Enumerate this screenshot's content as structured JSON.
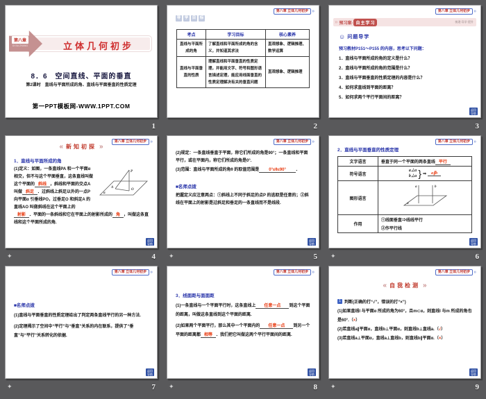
{
  "colors": {
    "background": "#59595b",
    "accent_red": "#c0392b",
    "answer_red": "#e8380d",
    "heading_blue": "#2531a8",
    "rose": "#c59191"
  },
  "chrome": {
    "transition_glyph": "✦",
    "page_numbers": [
      "1",
      "2",
      "3",
      "4",
      "5",
      "6",
      "7",
      "8",
      "9"
    ]
  },
  "common": {
    "chip_text": "第八章 立体几何初步",
    "chip_arrows": "»",
    "back_line1": "返回",
    "back_line2": "导航",
    "badge_l": "«",
    "badge_r": "»"
  },
  "s1": {
    "chapter": "第八章",
    "pinyin": "DI BA ZHANG",
    "title": "立体几何初步",
    "section": "8．6　空间直线、平面的垂直",
    "subtitle": "第2课时　直线与平面所成的角、直线与平面垂直的性质定理",
    "site": "第一PPT模板网-WWW.1PPT.COM"
  },
  "s2": {
    "stamps": [
      "导",
      "学",
      "目",
      "标"
    ],
    "table": {
      "headers": [
        "考点",
        "学习目标",
        "核心素养"
      ],
      "rows": [
        [
          "直线与平面所成的角",
          "了解直线和平面所成的角的含义，并知道其求法",
          "直观想象、逻辑推理、数学运算"
        ],
        [
          "直线与平面垂直的性质",
          "理解直线和平面垂直的性质定理，并能用文字、符号和图形语言描述定理，能应用线面垂直的性质定理解决有关的垂直问题",
          "直观想象、逻辑推理"
        ]
      ]
    }
  },
  "s3": {
    "banner_left": "预习案·",
    "banner_box": "自主学习",
    "banner_right": "梳理·导学·提升",
    "smiley": "☺",
    "qd_title": "问题导学",
    "lead": "预习教材P151～P155 的内容，思考以下问题：",
    "questions": [
      "1．直线与平面所成的角的定义是什么？",
      "2．直线与平面所成的角的范围是什么？",
      "3．直线与平面垂直的性质定理的内容是什么？",
      "4．如何求直线到平面的距离？",
      "5．如何求两个平行平面间的距离？"
    ]
  },
  "s4": {
    "badge": "新知初探",
    "heading": "1．直线与平面所成的角",
    "t1": "(1)定义：如图，一条直线PA 和一个平面α 相交，但不与这个平面垂直，这条直线叫做这个平面的",
    "b1": "斜线",
    "t2": "，斜线和平面的交点A 叫做",
    "b2": "斜足",
    "t3": "．过斜线上斜足以外的一点P 向平面α 引垂线PO，过垂足O 和斜足A 的直线AO 叫做斜线在这个平面上的",
    "b3": "射影",
    "t4": "．平面的一条斜线和它在平面上的射影所成的",
    "b4": "角",
    "t5": "，叫做这条直线和这个平面所成的角.",
    "fig": {
      "P": "P",
      "A": "A",
      "O": "O",
      "alpha": "α"
    }
  },
  "s5": {
    "p1": "(2)规定：一条直线垂直于平面，称它们所成的角是90°；一条直线和平面平行，或在平面内，称它们所成的角是0°.",
    "p2a": "(3)范围：直线与平面所成的角θ 的取值范围是",
    "p2b": "0°≤θ≤90°",
    "p2c": "．",
    "head": "■名师点拨",
    "p3": "把握定义应注意两点：①斜线上不同于斜足的点P 的选取是任意的；②斜线在平面上的射影是过斜足和垂足的一条直线而不是线段."
  },
  "s6": {
    "heading": "2．直线与平面垂直的性质定理",
    "r1_label": "文字语言",
    "r1_text": "垂直于同一个平面的两条直线",
    "r1_blank": "平行",
    "r2_label": "符号语言",
    "r2_l1": "a⊥α",
    "r2_l2": "b⊥α",
    "r2_brace": "}",
    "r2_arrow": "⇒",
    "r2_blank": "a∥b",
    "r3_label": "图形语言",
    "r3_a": "a",
    "r3_b": "b",
    "r3_alpha": "α",
    "r4_label": "作用",
    "r4_l1": "①线面垂直⇒线线平行",
    "r4_l2": "②作平行线"
  },
  "s7": {
    "head": "■名师点拨",
    "p1": "(1)直线与平面垂直的性质定理给出了判定两条直线平行的另一种方法.",
    "p2": "(2)定理揭示了空间中“平行”与“垂直”关系的内在联系，提供了“垂直”与“平行”关系转化的依据."
  },
  "s8": {
    "heading": "3．线面距与面面距",
    "t1": "(1)一条直线与一个平面平行时，这条直线上",
    "b1": "任意一点",
    "t2": "到这个平面的距离，叫做这条直线到这个平面的距离.",
    "t3": "(2)如果两个平面平行，那么其中一个平面内的",
    "b2": "任意一点",
    "t4": "到另一个平面的距离都",
    "b3": "相等",
    "t5": "．我们把它叫做这两个平行平面间的距离."
  },
  "s9": {
    "badge": "自我检测",
    "qicon": "1",
    "lead": "判断(正确的打“√”，错误的打“×”)",
    "items": [
      {
        "pre": "(1)如果直线l 与平面α 所成的角为60°，且m⊂α，则直线l 与m 所成的角也是60°.（",
        "mark": "×",
        "post": "）"
      },
      {
        "pre": "(2)若直线a∥平面α，直线b⊥平面α，则直线b⊥直线a.（",
        "mark": "√",
        "post": "）"
      },
      {
        "pre": "(3)若直线a⊥平面α，直线a⊥直线b，则直线b∥平面α.（",
        "mark": "×",
        "post": "）"
      }
    ]
  }
}
